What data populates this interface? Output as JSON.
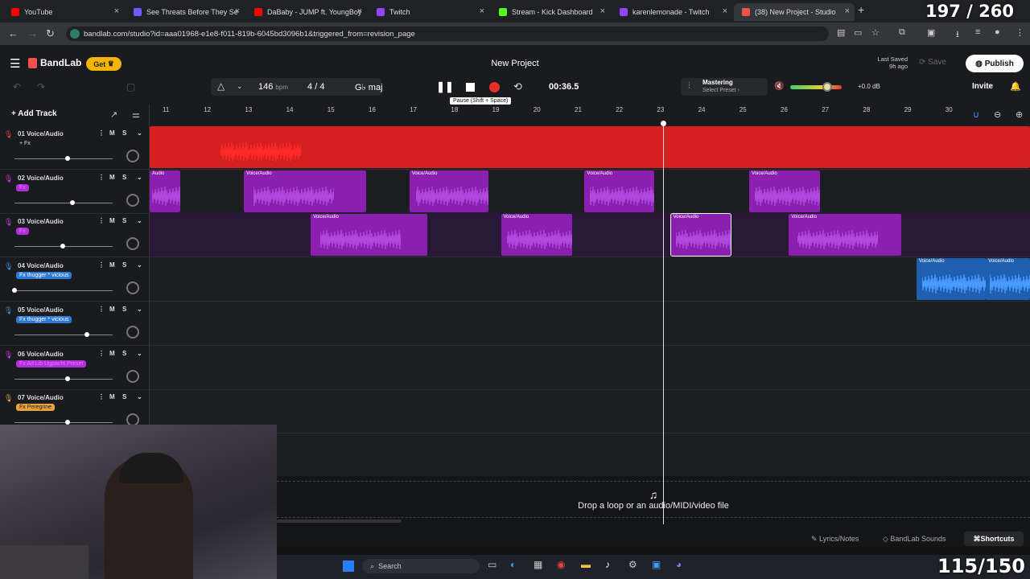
{
  "tabs": [
    {
      "title": "YouTube",
      "color": "#ff0000"
    },
    {
      "title": "See Threats Before They Se",
      "color": "#6b5cff"
    },
    {
      "title": "DaBaby - JUMP ft. YoungBoy",
      "color": "#ff0000"
    },
    {
      "title": "Twitch",
      "color": "#9146ff"
    },
    {
      "title": "Stream - Kick Dashboard",
      "color": "#53fc18"
    },
    {
      "title": "karenlemonade - Twitch",
      "color": "#9146ff"
    },
    {
      "title": "(38) New Project - Studio",
      "color": "#f2504b"
    }
  ],
  "browser": {
    "url": "bandlab.com/studio?id=aaa01968-e1e8-f011-819b-6045bd3096b1&triggered_from=revision_page",
    "get_label": "Get"
  },
  "app": {
    "logo": "BandLab",
    "get_label": "Get",
    "project_title": "New Project",
    "last_saved_label": "Last Saved",
    "last_saved_value": "9h ago",
    "save_label": "Save",
    "publish_label": "Publish",
    "invite_label": "Invite"
  },
  "transport": {
    "bpm": "146",
    "bpm_unit": "bpm",
    "time_sig_num": "4",
    "time_sig_sep": "/",
    "time_sig_den": "4",
    "key": "G♭ maj",
    "time": "00:36.5",
    "tooltip": "Pause (Shift + Space)",
    "mastering_label": "Mastering",
    "mastering_preset": "Select Preset ›",
    "volume_db": "+0.0 dB",
    "volume_level": 0.72
  },
  "ruler": {
    "ticks": [
      "11",
      "12",
      "13",
      "14",
      "15",
      "16",
      "17",
      "18",
      "19",
      "20",
      "21",
      "22",
      "23",
      "24",
      "25",
      "26",
      "27",
      "28",
      "29",
      "30"
    ]
  },
  "add_track_label": "Add Track",
  "tracks": [
    {
      "num": "01",
      "name": "Voice/Audio",
      "fx": "+ Fx",
      "color": "#e8453c",
      "fxbg": "transparent",
      "fxcolor": "#ddd",
      "vol": 0.55
    },
    {
      "num": "02",
      "name": "Voice/Audio",
      "fx": "Fx",
      "color": "#c93ee0",
      "fxbg": "#b02fd8",
      "fxcolor": "#e87cff",
      "vol": 0.6
    },
    {
      "num": "03",
      "name": "Voice/Audio",
      "fx": "Fx",
      "color": "#c93ee0",
      "fxbg": "#b02fd8",
      "fxcolor": "#e87cff",
      "vol": 0.5
    },
    {
      "num": "04",
      "name": "Voice/Audio",
      "fx": "Fx thugger * vicious",
      "color": "#3d8fe0",
      "fxbg": "#2d7ad6",
      "fxcolor": "#fff",
      "vol": 0.0
    },
    {
      "num": "05",
      "name": "Voice/Audio",
      "fx": "Fx thugger * vicious",
      "color": "#3d8fe0",
      "fxbg": "#2d7ad6",
      "fxcolor": "#fff",
      "vol": 0.75
    },
    {
      "num": "06",
      "name": "Voice/Audio",
      "fx": "Fx Ad Lib Ugpacht Preset",
      "color": "#c93ee0",
      "fxbg": "#b02fd8",
      "fxcolor": "#e87cff",
      "vol": 0.55
    },
    {
      "num": "07",
      "name": "Voice/Audio",
      "fx": "Fx Peregrine",
      "color": "#e8a23c",
      "fxbg": "#e8a23c",
      "fxcolor": "#222",
      "vol": 0.55
    }
  ],
  "clips": [
    {
      "lane": 0,
      "label": "",
      "start": 0.0,
      "end": 1.0,
      "color": "#d42020",
      "wave": "#ff2a2a"
    },
    {
      "lane": 1,
      "label": "Audio",
      "start": 0.0,
      "end": 0.035,
      "color": "#8a1fb0",
      "wave": "#b14be0"
    },
    {
      "lane": 1,
      "label": "Voice/Audio",
      "start": 0.107,
      "end": 0.246,
      "color": "#8a1fb0",
      "wave": "#b14be0"
    },
    {
      "lane": 1,
      "label": "Voice/Audio",
      "start": 0.295,
      "end": 0.385,
      "color": "#8a1fb0",
      "wave": "#b14be0"
    },
    {
      "lane": 1,
      "label": "Voice/Audio",
      "start": 0.494,
      "end": 0.573,
      "color": "#8a1fb0",
      "wave": "#b14be0"
    },
    {
      "lane": 1,
      "label": "Voice/Audio",
      "start": 0.681,
      "end": 0.761,
      "color": "#8a1fb0",
      "wave": "#b14be0"
    },
    {
      "lane": 2,
      "label": "Voice/Audio",
      "start": 0.183,
      "end": 0.315,
      "color": "#8a1fb0",
      "wave": "#b14be0"
    },
    {
      "lane": 2,
      "label": "Voice/Audio",
      "start": 0.399,
      "end": 0.48,
      "color": "#8a1fb0",
      "wave": "#b14be0"
    },
    {
      "lane": 2,
      "label": "Voice/Audio",
      "start": 0.592,
      "end": 0.66,
      "color": "#8a1fb0",
      "wave": "#b14be0"
    },
    {
      "lane": 2,
      "label": "Voice/Audio",
      "start": 0.726,
      "end": 0.854,
      "color": "#8a1fb0",
      "wave": "#b14be0"
    },
    {
      "lane": 3,
      "label": "Voice/Audio",
      "start": 0.871,
      "end": 0.95,
      "color": "#1f5fb0",
      "wave": "#4a9cff"
    },
    {
      "lane": 3,
      "label": "Voice/Audio",
      "start": 0.95,
      "end": 1.0,
      "color": "#1f5fb0",
      "wave": "#4a9cff"
    }
  ],
  "drop_text": "Drop a loop or an audio/MIDI/video file",
  "footer": {
    "lyrics": "Lyrics/Notes",
    "sounds": "BandLab Sounds",
    "shortcuts": "Shortcuts"
  },
  "taskbar": {
    "search": "Search"
  },
  "overlays": {
    "top_counter": "197 / 260",
    "bottom_counter": "115/150"
  }
}
